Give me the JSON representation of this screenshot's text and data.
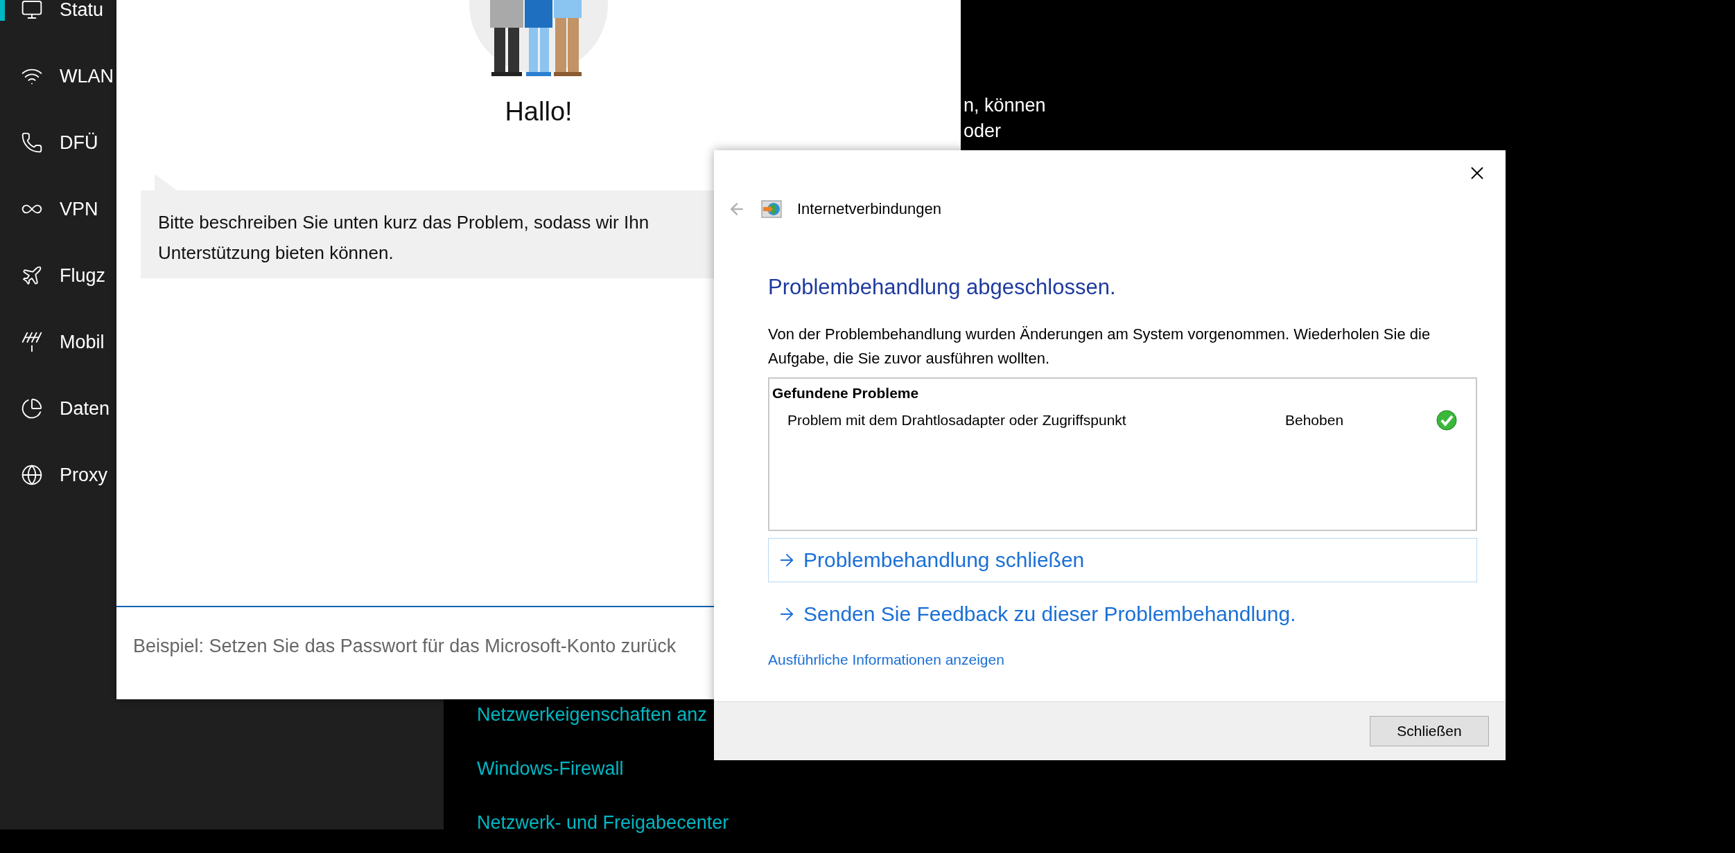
{
  "sidebar": {
    "items": [
      {
        "label": "Statu",
        "selected": true
      },
      {
        "label": "WLAN",
        "selected": false
      },
      {
        "label": "DFÜ",
        "selected": false
      },
      {
        "label": "VPN",
        "selected": false
      },
      {
        "label": "Flugz",
        "selected": false
      },
      {
        "label": "Mobil",
        "selected": false
      },
      {
        "label": "Daten",
        "selected": false
      },
      {
        "label": "Proxy",
        "selected": false
      }
    ]
  },
  "background_page": {
    "texts": [
      "n, können",
      "oder"
    ],
    "links": [
      "Netzwerkeigenschaften anz",
      "Windows-Firewall",
      "Netzwerk- und Freigabecenter"
    ]
  },
  "help_window": {
    "greeting": "Hallo!",
    "message": [
      "Bitte beschreiben Sie unten kurz das Problem, sodass wir Ihn",
      "Unterstützung bieten können."
    ],
    "input": {
      "placeholder": "Beispiel: Setzen Sie das Passwort für das Microsoft-Konto zurück"
    }
  },
  "troubleshooter": {
    "title": "Internetverbindungen",
    "heading": "Problembehandlung abgeschlossen.",
    "description": "Von der Problembehandlung wurden Änderungen am System vorgenommen. Wiederholen Sie die Aufgabe, die Sie zuvor ausführen wollten.",
    "problems": {
      "header": "Gefundene Probleme",
      "rows": [
        {
          "problem": "Problem mit dem Drahtlosadapter oder Zugriffspunkt",
          "status": "Behoben",
          "resolved": true
        }
      ]
    },
    "actions": [
      {
        "label": "Problembehandlung schließen",
        "focused": true
      },
      {
        "label": "Senden Sie Feedback zu dieser Problembehandlung.",
        "focused": false
      }
    ],
    "details_link": "Ausführliche Informationen anzeigen",
    "buttons": [
      "Schließen"
    ]
  }
}
